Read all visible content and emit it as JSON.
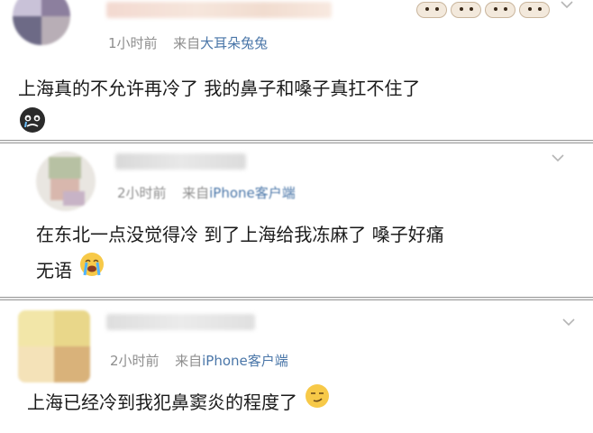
{
  "posts": [
    {
      "time": "1小时前",
      "from_prefix": "来自",
      "source": "大耳朵兔兔",
      "text": "上海真的不允许再冷了 我的鼻子和嗓子真扛不住了",
      "emoji": "crying-face-emoji"
    },
    {
      "time": "2小时前",
      "from_prefix": "来自",
      "source": "iPhone客户端",
      "text_line1": "在东北一点没觉得冷 到了上海给我冻麻了 嗓子好痛",
      "text_line2": "无语",
      "emoji": "loudly-crying-face-emoji"
    },
    {
      "time": "2小时前",
      "from_prefix": "来自",
      "source": "iPhone客户端",
      "text": "上海已经冷到我犯鼻窦炎的程度了",
      "emoji": "smirk-face-emoji"
    }
  ],
  "colors": {
    "meta_gray": "#8e8e8e",
    "source_blue": "#4a76a8",
    "separator": "#ededed"
  },
  "icons": [
    "chevron-down-icon",
    "user-badge-icon"
  ]
}
